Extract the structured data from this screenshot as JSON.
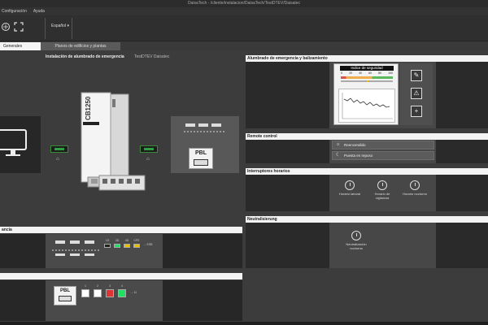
{
  "window": {
    "title": "DaisaTech - /cliente/instalacion/DaisaTech/TestDTEV/Daisatec"
  },
  "menu": [
    "Configuración",
    "Ayuda"
  ],
  "ribbon": {
    "language": "Español",
    "language_arrow": "▾"
  },
  "tabs": [
    {
      "label": "Generales",
      "active": true
    },
    {
      "label": "Planos de edificios y plantas",
      "active": false
    }
  ],
  "main": {
    "title": "Instalación de alumbrado de emergencia",
    "subtitle": "TestDTEV Daisatec",
    "device_label": "CB1250",
    "pbl_label": "PBL"
  },
  "left_panels": [
    {
      "title": "ancia"
    },
    {
      "title": ""
    }
  ],
  "bus_labels": [
    "1D",
    "3D",
    "4D",
    "CFE",
    "ESB"
  ],
  "pbl_bottom": {
    "label": "PBL",
    "items": [
      "1",
      "2",
      "3",
      "4"
    ],
    "arrow_value": "11"
  },
  "right_panels": {
    "alumbrado": {
      "title": "Alumbrado de emergencia y balizamiento",
      "indicator_title": "Indice de seguridad",
      "scale": [
        "0",
        "20",
        "40",
        "60",
        "80",
        "100"
      ]
    },
    "remote": {
      "title": "Remote control",
      "buttons": [
        "Reencendido",
        "Puesta en reposo"
      ]
    },
    "interruptores": {
      "title": "Interruptores horarios",
      "items": [
        "Horario laboral",
        "Horario de vigilancia",
        "Horario nocturno"
      ]
    },
    "neutralizacion": {
      "title": "Neutralisierung",
      "items": [
        "Neutralización nocturna"
      ]
    }
  },
  "colors": {
    "accent_green": "#2ea043",
    "header_bg": "#f3f3f3",
    "panel_dark": "#272727"
  }
}
